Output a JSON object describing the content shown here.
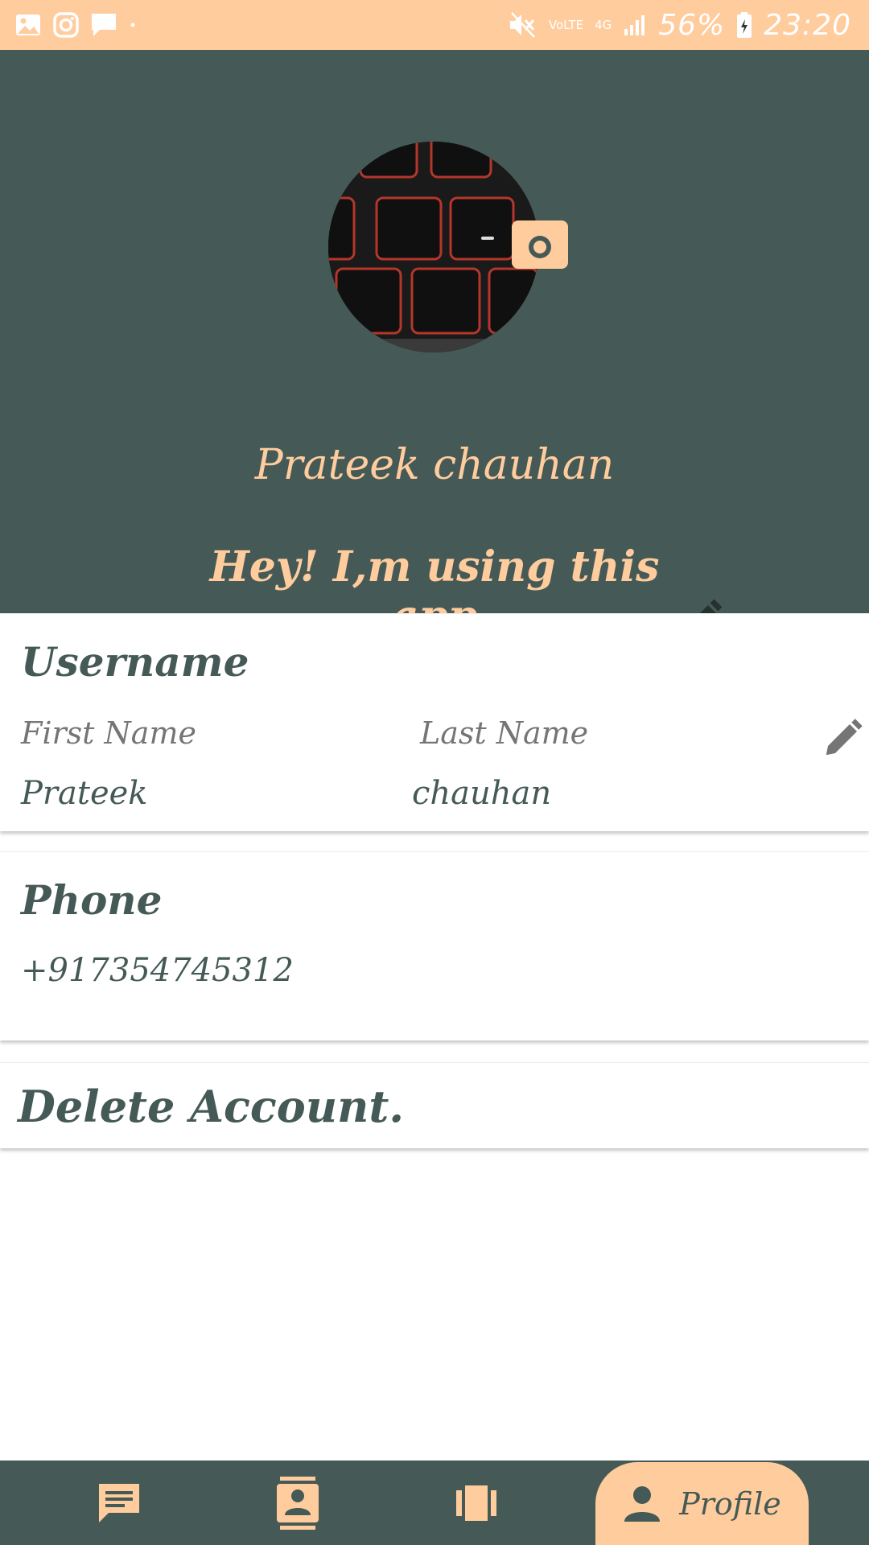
{
  "status_bar": {
    "network": "VoLTE",
    "network_type": "4G",
    "battery": "56%",
    "time": "23:20",
    "icons": [
      "gallery-icon",
      "instagram-icon",
      "message-icon",
      "mute-icon",
      "signal-icon",
      "battery-icon"
    ]
  },
  "profile": {
    "name": "Prateek chauhan",
    "status": "Hey! I,m using this app"
  },
  "username_card": {
    "title": "Username",
    "first_name_label": "First Name",
    "last_name_label": "Last Name",
    "first_name": "Prateek",
    "last_name": "chauhan"
  },
  "phone_card": {
    "title": "Phone",
    "number": "+917354745312"
  },
  "delete_card": {
    "title": "Delete Account."
  },
  "bottom_nav": {
    "items": [
      {
        "icon": "chat-icon"
      },
      {
        "icon": "contacts-icon"
      },
      {
        "icon": "stories-icon"
      },
      {
        "icon": "person-icon",
        "label": "Profile",
        "active": true
      }
    ]
  },
  "colors": {
    "primary": "#455a56",
    "accent": "#ffcc9e",
    "label_gray": "#757575"
  }
}
